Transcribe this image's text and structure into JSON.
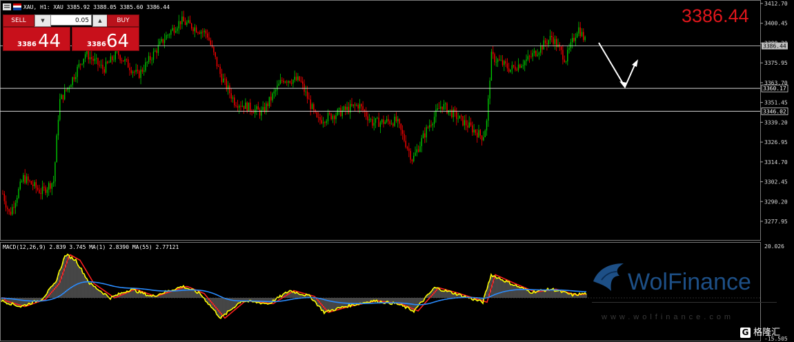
{
  "header": {
    "symbol_text": "XAU, H1:  XAU  3385.92 3388.05 3385.60 3386.44"
  },
  "trade_panel": {
    "sell_label": "SELL",
    "buy_label": "BUY",
    "lot_value": "0.05",
    "sell_price_small": "3386",
    "sell_price_big": "44",
    "buy_price_small": "3386",
    "buy_price_big": "64"
  },
  "big_price": "3386.44",
  "price_axis": {
    "ticks": [
      "3412.70",
      "3400.45",
      "3388.20",
      "3375.95",
      "3363.70",
      "3351.45",
      "3339.20",
      "3326.95",
      "3314.70",
      "3302.45",
      "3290.20",
      "3277.95"
    ],
    "current_label": "3386.44",
    "level_labels": [
      "3360.17",
      "3346.02"
    ]
  },
  "macd": {
    "label": "MACD(12,26,9) 2.839 3.745 MA(1) 2.8390 MA(55) 2.77121",
    "axis_top": "20.026",
    "axis_bottom": "-15.505"
  },
  "watermark": {
    "brand": "WolFinance",
    "url": "www.wolfinance.com",
    "logo2": "格隆汇"
  },
  "colors": {
    "bull": "#00c800",
    "bear": "#ff0000",
    "line": "#c0c0c0",
    "macd_yellow": "#ffff00",
    "macd_red": "#ff2020",
    "macd_blue": "#2a8cff",
    "accent": "#e0161b"
  }
}
